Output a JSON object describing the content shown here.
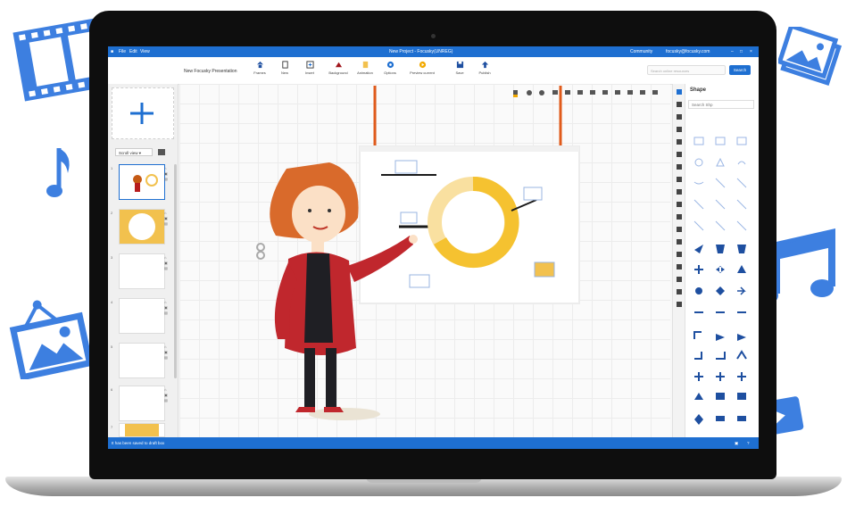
{
  "app": {
    "title": "New Project - Focusky(UNREG)",
    "menu": [
      "File",
      "Edit",
      "View"
    ],
    "account_links": [
      "Community",
      "focusky@focusky.com"
    ],
    "accent_color": "#1e6fd1"
  },
  "toolbar": {
    "doc_title": "New Focusky Presentation",
    "buttons": [
      {
        "label": "Frames",
        "icon": "frames-icon"
      },
      {
        "label": "New",
        "icon": "new-file-icon"
      },
      {
        "label": "Insert",
        "icon": "insert-icon"
      },
      {
        "label": "Background",
        "icon": "background-icon"
      },
      {
        "label": "Animation",
        "icon": "animation-icon"
      },
      {
        "label": "Options",
        "icon": "options-icon"
      },
      {
        "label": "Preview current",
        "icon": "preview-icon"
      },
      {
        "label": "Save",
        "icon": "save-icon"
      },
      {
        "label": "Publish",
        "icon": "publish-icon"
      }
    ],
    "search_placeholder": "Search online resources",
    "search_button": "Search"
  },
  "left_panel": {
    "dropdown_label": "Scroll view",
    "slides": [
      {
        "number": "1"
      },
      {
        "number": "2"
      },
      {
        "number": "3"
      },
      {
        "number": "4"
      },
      {
        "number": "5"
      },
      {
        "number": "6"
      },
      {
        "number": "7"
      }
    ]
  },
  "right_panel": {
    "title": "Shape",
    "search_placeholder": "Search Shp"
  },
  "status_bar": {
    "message": "It has been saved to draft box"
  }
}
